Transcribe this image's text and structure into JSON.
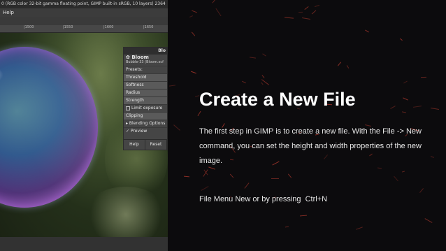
{
  "gimp": {
    "title_bar": "0 (RGB color 32-bit gamma floating point, GIMP built-in sRGB, 10 layers) 2364",
    "menu_help": "Help",
    "ruler_ticks": [
      "|1500",
      "|1550",
      "|1600",
      "|1650"
    ]
  },
  "bloom_dialog": {
    "title": "Blo",
    "name": "Bloom",
    "layer": "Bubble-33 (Bloom.xcf",
    "presets_label": "Presets:",
    "threshold_label": "Threshold",
    "softness_label": "Softness",
    "radius_label": "Radius",
    "strength_label": "Strength",
    "limit_exposure_label": "Limit exposure",
    "clipping_label": "Clipping",
    "blending_options_label": "Blending Options",
    "preview_label": "Preview",
    "help_button": "Help",
    "reset_button": "Reset"
  },
  "slide": {
    "title": "Create a New File",
    "body": "The first step in GIMP is to create a new file. With the File -> New command, you can set the height and width properties of the new image.",
    "footer": "File Menu New or by pressing  Ctrl+N",
    "accent_color": "#b33a2e"
  }
}
